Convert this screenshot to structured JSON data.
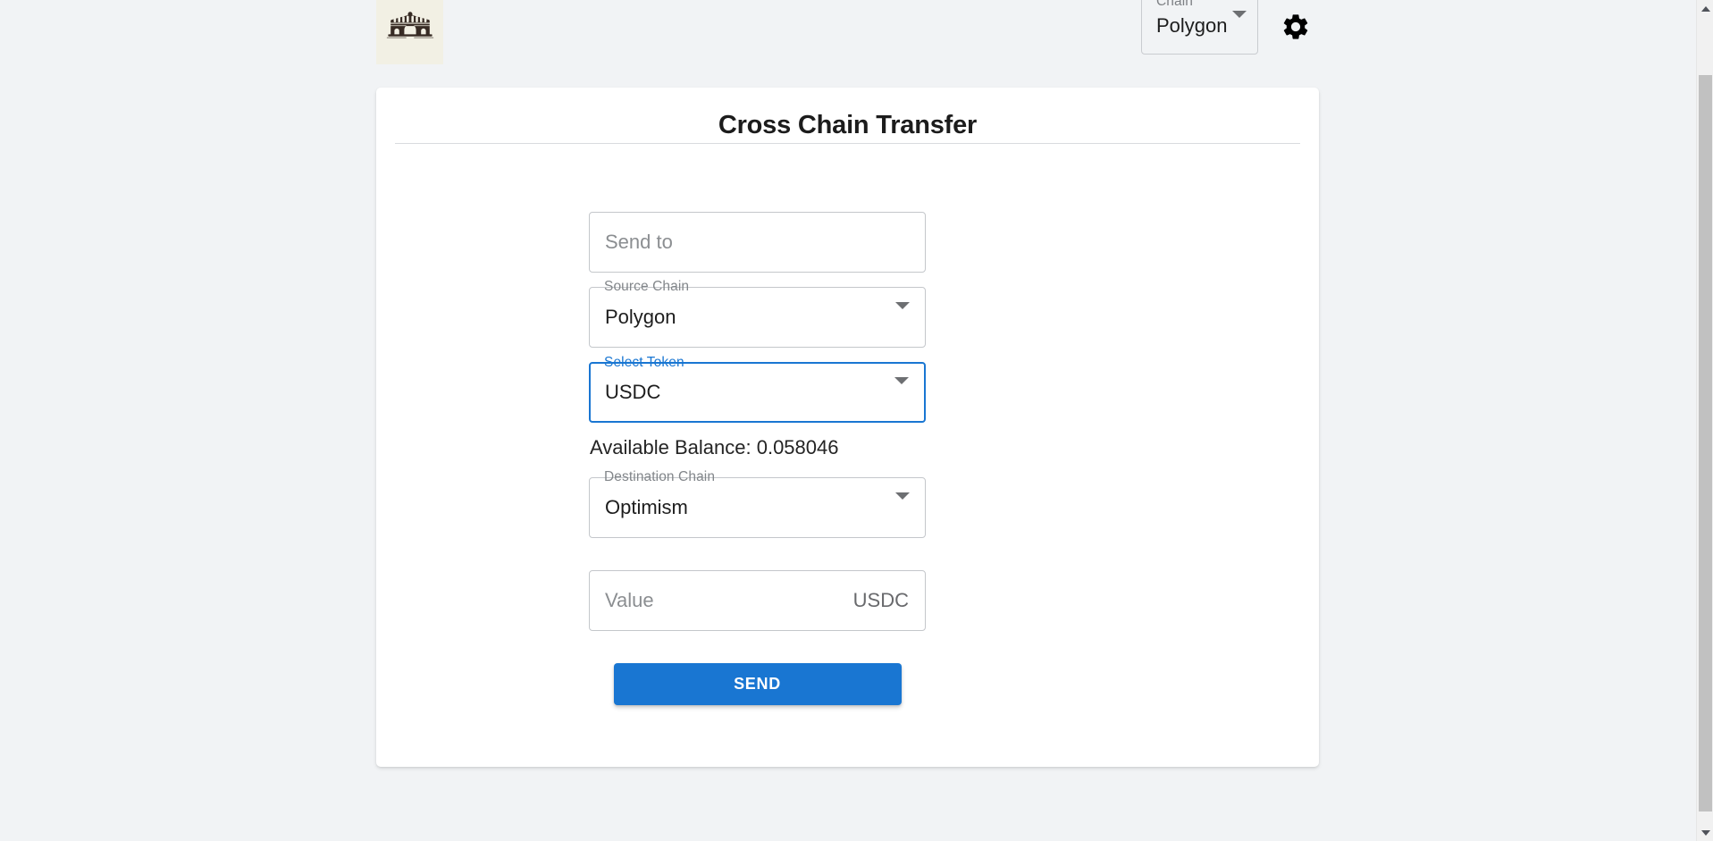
{
  "app": {
    "background_color": "#f1f3f5",
    "accent_color": "#1976d2",
    "logo_icon": "bridge-icon",
    "logo_background": "#f2f0e4"
  },
  "header": {
    "chain_selector": {
      "label": "Chain",
      "value": "Polygon",
      "caret_icon": "chevron-down-icon"
    },
    "settings_button": {
      "icon": "gear-icon"
    }
  },
  "card": {
    "title": "Cross Chain Transfer"
  },
  "form": {
    "send_to": {
      "label": "",
      "placeholder": "Send to",
      "value": ""
    },
    "source_chain": {
      "label": "Source Chain",
      "value": "Polygon",
      "caret_icon": "chevron-down-icon"
    },
    "select_token": {
      "label": "Select Token",
      "value": "USDC",
      "caret_icon": "chevron-down-icon",
      "focused": true
    },
    "available_balance": "Available Balance: 0.058046",
    "destination_chain": {
      "label": "Destination Chain",
      "value": "Optimism",
      "caret_icon": "chevron-down-icon"
    },
    "value_field": {
      "placeholder": "Value",
      "value": "",
      "adornment": "USDC"
    },
    "send_button": {
      "label": "SEND"
    }
  },
  "scrollbar": {
    "up_icon": "scroll-up-arrow-icon",
    "down_icon": "scroll-down-arrow-icon"
  }
}
